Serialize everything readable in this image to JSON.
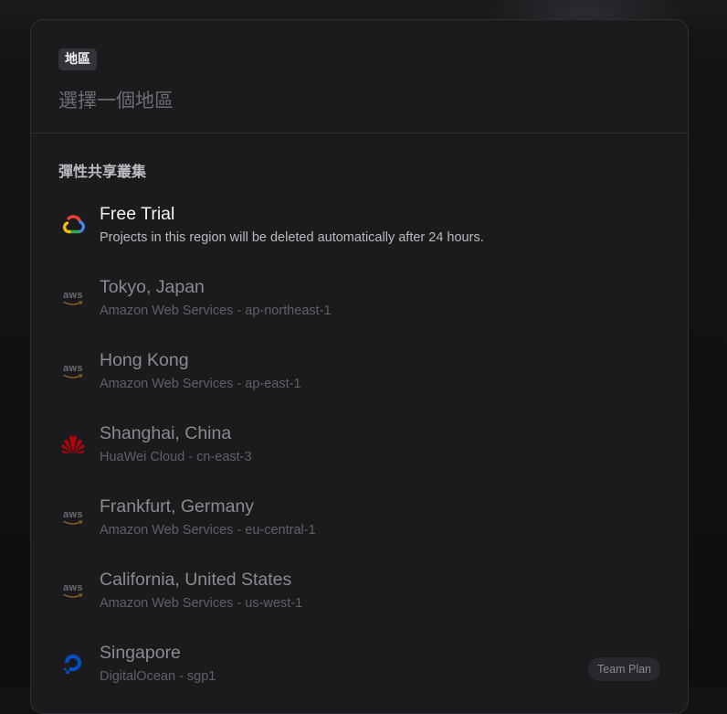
{
  "header": {
    "badge_label": "地區",
    "search_placeholder": "選擇一個地區"
  },
  "section": {
    "title": "彈性共享叢集"
  },
  "regions": [
    {
      "name": "Free Trial",
      "subtitle": "Projects in this region will be deleted automatically after 24 hours.",
      "provider_icon": "google-cloud-icon"
    },
    {
      "name": "Tokyo, Japan",
      "subtitle": "Amazon Web Services - ap-northeast-1",
      "provider_icon": "aws-icon",
      "icon_text": "aws"
    },
    {
      "name": "Hong Kong",
      "subtitle": "Amazon Web Services - ap-east-1",
      "provider_icon": "aws-icon",
      "icon_text": "aws"
    },
    {
      "name": "Shanghai, China",
      "subtitle": "HuaWei Cloud - cn-east-3",
      "provider_icon": "huawei-icon"
    },
    {
      "name": "Frankfurt, Germany",
      "subtitle": "Amazon Web Services - eu-central-1",
      "provider_icon": "aws-icon",
      "icon_text": "aws"
    },
    {
      "name": "California, United States",
      "subtitle": "Amazon Web Services - us-west-1",
      "provider_icon": "aws-icon",
      "icon_text": "aws"
    },
    {
      "name": "Singapore",
      "subtitle": "DigitalOcean - sgp1",
      "provider_icon": "digitalocean-icon",
      "badge": "Team Plan"
    }
  ],
  "colors": {
    "panel_background": "#1b1b1e",
    "google_blue": "#4285f4",
    "google_red": "#ea4335",
    "google_yellow": "#fbbc04",
    "google_green": "#34a853",
    "huawei_red": "#c7000b",
    "digitalocean_blue": "#0069ff"
  }
}
